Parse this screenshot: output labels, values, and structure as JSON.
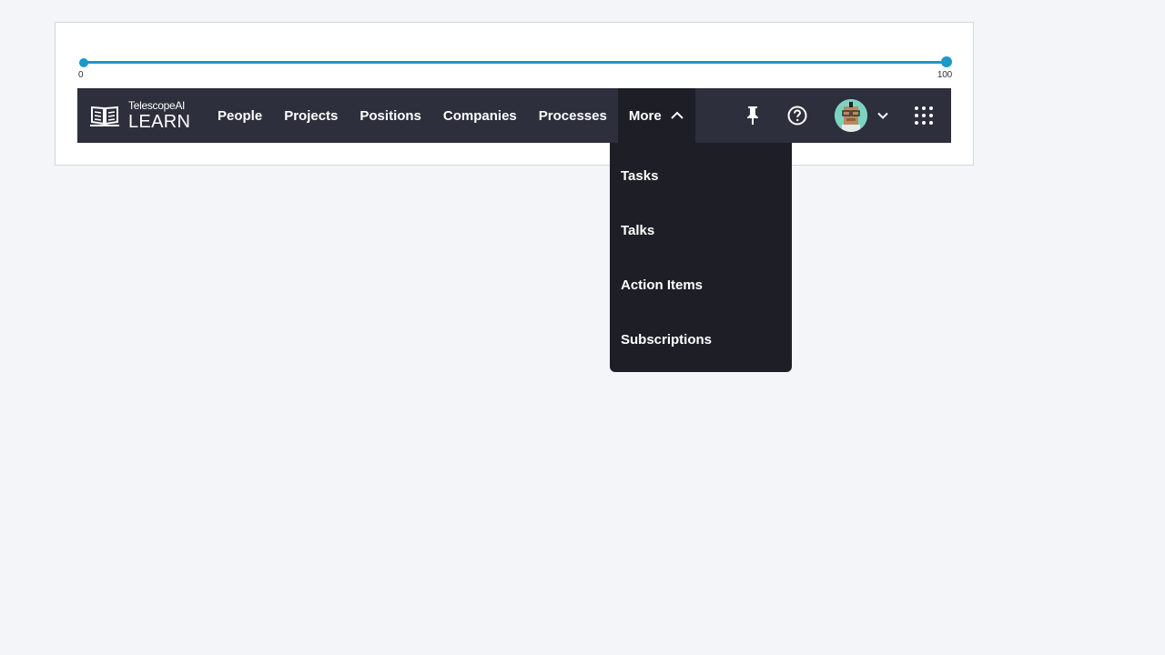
{
  "slider": {
    "min_label": "0",
    "max_label": "100",
    "value_low": 0,
    "value_high": 100,
    "accent_color": "#1a9ac6"
  },
  "brand": {
    "subtitle": "TelescopeAI",
    "title": "LEARN",
    "icon": "open-book-icon"
  },
  "nav": {
    "items": [
      {
        "label": "People"
      },
      {
        "label": "Projects"
      },
      {
        "label": "Positions"
      },
      {
        "label": "Companies"
      },
      {
        "label": "Processes"
      }
    ],
    "more_label": "More",
    "more_icon": "chevron-up-icon"
  },
  "toolbar": {
    "pin_icon": "pin-icon",
    "help_icon": "help-circle-icon",
    "avatar_icon": "avatar",
    "account_chevron_icon": "chevron-down-icon",
    "apps_icon": "grid-dots-icon"
  },
  "dropdown": {
    "items": [
      {
        "label": "Tasks"
      },
      {
        "label": "Talks"
      },
      {
        "label": "Action Items"
      },
      {
        "label": "Subscriptions"
      }
    ]
  },
  "colors": {
    "navbar_bg": "#2d2f3c",
    "active_bg": "#1d1e26",
    "page_bg": "#f4f5f9"
  }
}
